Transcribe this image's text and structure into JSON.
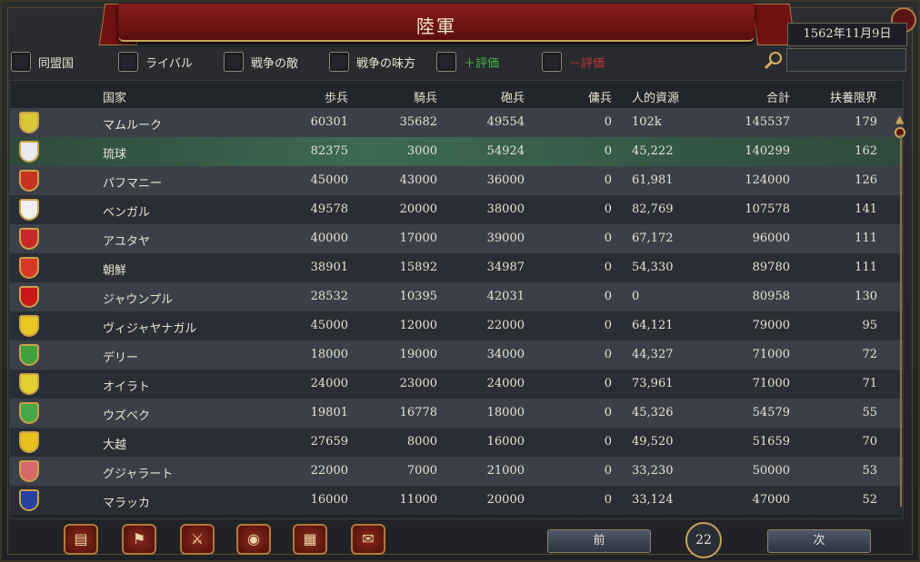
{
  "title": "陸軍",
  "date": "1562年11月9日",
  "filters": [
    {
      "label": "同盟国",
      "color": "#e8e2d2"
    },
    {
      "label": "ライバル",
      "color": "#e8e2d2"
    },
    {
      "label": "戦争の敵",
      "color": "#e8e2d2"
    },
    {
      "label": "戦争の味方",
      "color": "#e8e2d2"
    },
    {
      "label": "＋評価",
      "color": "#46b446"
    },
    {
      "label": "－評価",
      "color": "#c83232"
    }
  ],
  "columns": [
    "国家",
    "歩兵",
    "騎兵",
    "砲兵",
    "傭兵",
    "人的資源",
    "合計",
    "扶養限界"
  ],
  "rows": [
    {
      "name": "マムルーク",
      "inf": "60301",
      "cav": "35682",
      "art": "49554",
      "merc": "0",
      "mp": "102k",
      "total": "145537",
      "limit": "179",
      "shield": "#d8c838"
    },
    {
      "name": "琉球",
      "inf": "82375",
      "cav": "3000",
      "art": "54924",
      "merc": "0",
      "mp": "45,222",
      "total": "140299",
      "limit": "162",
      "shield": "#e8e8f0"
    },
    {
      "name": "パフマニー",
      "inf": "45000",
      "cav": "43000",
      "art": "36000",
      "merc": "0",
      "mp": "61,981",
      "total": "124000",
      "limit": "126",
      "shield": "#c83020"
    },
    {
      "name": "ベンガル",
      "inf": "49578",
      "cav": "20000",
      "art": "38000",
      "merc": "0",
      "mp": "82,769",
      "total": "107578",
      "limit": "141",
      "shield": "#f0f0f0"
    },
    {
      "name": "アユタヤ",
      "inf": "40000",
      "cav": "17000",
      "art": "39000",
      "merc": "0",
      "mp": "67,172",
      "total": "96000",
      "limit": "111",
      "shield": "#c82828"
    },
    {
      "name": "朝鮮",
      "inf": "38901",
      "cav": "15892",
      "art": "34987",
      "merc": "0",
      "mp": "54,330",
      "total": "89780",
      "limit": "111",
      "shield": "#d83828"
    },
    {
      "name": "ジャウンプル",
      "inf": "28532",
      "cav": "10395",
      "art": "42031",
      "merc": "0",
      "mp": "0",
      "total": "80958",
      "limit": "130",
      "shield": "#c81818"
    },
    {
      "name": "ヴィジャヤナガル",
      "inf": "45000",
      "cav": "12000",
      "art": "22000",
      "merc": "0",
      "mp": "64,121",
      "total": "79000",
      "limit": "95",
      "shield": "#e8c820"
    },
    {
      "name": "デリー",
      "inf": "18000",
      "cav": "19000",
      "art": "34000",
      "merc": "0",
      "mp": "44,327",
      "total": "71000",
      "limit": "72",
      "shield": "#40a040"
    },
    {
      "name": "オイラト",
      "inf": "24000",
      "cav": "23000",
      "art": "24000",
      "merc": "0",
      "mp": "73,961",
      "total": "71000",
      "limit": "71",
      "shield": "#e0d030"
    },
    {
      "name": "ウズベク",
      "inf": "19801",
      "cav": "16778",
      "art": "18000",
      "merc": "0",
      "mp": "45,326",
      "total": "54579",
      "limit": "55",
      "shield": "#48a848"
    },
    {
      "name": "大越",
      "inf": "27659",
      "cav": "8000",
      "art": "16000",
      "merc": "0",
      "mp": "49,520",
      "total": "51659",
      "limit": "70",
      "shield": "#e8c020"
    },
    {
      "name": "グジャラート",
      "inf": "22000",
      "cav": "7000",
      "art": "21000",
      "merc": "0",
      "mp": "33,230",
      "total": "50000",
      "limit": "53",
      "shield": "#d86868"
    },
    {
      "name": "マラッカ",
      "inf": "16000",
      "cav": "11000",
      "art": "20000",
      "merc": "0",
      "mp": "33,124",
      "total": "47000",
      "limit": "52",
      "shield": "#2840a0"
    }
  ],
  "pagination": {
    "prev": "前",
    "next": "次",
    "page": "22"
  },
  "bottom_icons": [
    "ledger-icon",
    "flag-icon",
    "swords-icon",
    "coins-icon",
    "trade-icon",
    "diplomacy-icon"
  ]
}
